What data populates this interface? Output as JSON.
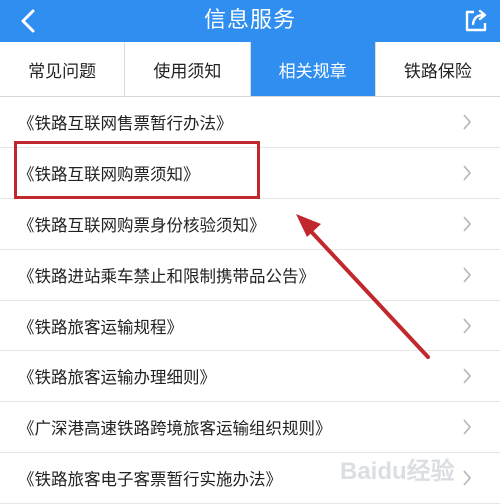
{
  "header": {
    "title": "信息服务",
    "back_icon": "back-chevron-icon",
    "share_icon": "share-icon"
  },
  "tabs": [
    {
      "label": "常见问题",
      "active": false
    },
    {
      "label": "使用须知",
      "active": false
    },
    {
      "label": "相关规章",
      "active": true
    },
    {
      "label": "铁路保险",
      "active": false
    }
  ],
  "list": {
    "items": [
      {
        "label": "《铁路互联网售票暂行办法》"
      },
      {
        "label": "《铁路互联网购票须知》"
      },
      {
        "label": "《铁路互联网购票身份核验须知》"
      },
      {
        "label": "《铁路进站乘车禁止和限制携带品公告》"
      },
      {
        "label": "《铁路旅客运输规程》"
      },
      {
        "label": "《铁路旅客运输办理细则》"
      },
      {
        "label": "《广深港高速铁路跨境旅客运输组织规则》"
      },
      {
        "label": "《铁路旅客电子客票暂行实施办法》"
      }
    ]
  },
  "annotation": {
    "highlight_color": "#c0282d",
    "arrow_color": "#c0282d"
  },
  "colors": {
    "accent": "#2f8ef0"
  },
  "watermark": {
    "text": "Baidu经验"
  }
}
